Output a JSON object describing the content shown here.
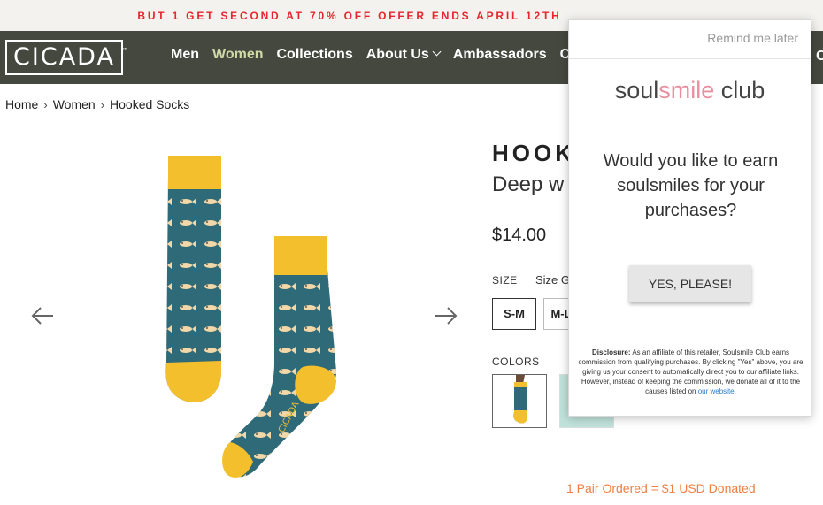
{
  "promo": {
    "text": "BUT 1 GET SECOND AT 70% OFF OFFER ENDS APRIL 12TH"
  },
  "header": {
    "logo": "CICADA",
    "logo_mark": "™",
    "nav": [
      {
        "label": "Men"
      },
      {
        "label": "Women"
      },
      {
        "label": "Collections"
      },
      {
        "label": "About Us"
      },
      {
        "label": "Ambassadors"
      },
      {
        "label": "C"
      }
    ],
    "right_fragment": "C"
  },
  "breadcrumb": {
    "items": [
      "Home",
      "Women",
      "Hooked Socks"
    ],
    "separator": "›"
  },
  "product": {
    "title": "HOOK",
    "subtitle": "Deep w",
    "price": "$14.00",
    "size_label": "SIZE",
    "size_guide": "Size G",
    "sizes": [
      "S-M",
      "M-L"
    ],
    "colors_label": "COLORS",
    "donation": "1 Pair Ordered = $1 USD Donated",
    "image_logo": "CICADA"
  },
  "popup": {
    "remind": "Remind me later",
    "brand_part1": "soul",
    "brand_part2": "smile",
    "brand_part3": " club",
    "question": "Would you like to earn soulsmiles for your purchases?",
    "yes_button": "YES, PLEASE!",
    "disclosure_label": "Disclosure:",
    "disclosure_text": " As an affiliate of this retailer, Soulsmile Club earns commission from qualifying purchases. By clicking \"Yes\" above, you are giving us your consent to automatically direct you to our affiliate links. However, instead of keeping the commission, we donate all of it to the causes listed on ",
    "disclosure_link": "our website",
    "disclosure_end": "."
  },
  "colors": {
    "promo_red": "#e8242e",
    "nav_bg": "#45483f",
    "nav_active": "#d1d8a8",
    "sock_teal": "#2f6a78",
    "sock_yellow": "#f4bf2c",
    "brand_pink": "#e8909f",
    "donation_orange": "#f07f41"
  },
  "icons": {
    "prev": "chevron-left-icon",
    "next": "chevron-right-icon",
    "caret": "chevron-down-icon"
  }
}
